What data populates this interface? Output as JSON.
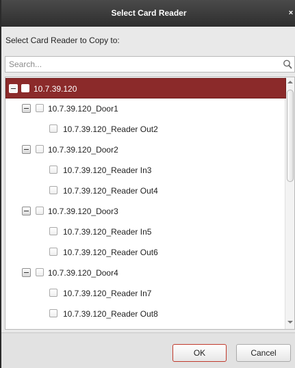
{
  "dialog": {
    "title": "Select Card Reader",
    "close_glyph": "×",
    "prompt": "Select Card Reader to Copy to:"
  },
  "search": {
    "placeholder": "Search...",
    "value": "",
    "icon": "search-icon"
  },
  "tree": {
    "items": [
      {
        "label": "10.7.39.120",
        "level": 0,
        "expandable": true,
        "selected": true,
        "checked": false
      },
      {
        "label": "10.7.39.120_Door1",
        "level": 1,
        "expandable": true,
        "selected": false,
        "checked": false
      },
      {
        "label": "10.7.39.120_Reader Out2",
        "level": 2,
        "expandable": false,
        "selected": false,
        "checked": false
      },
      {
        "label": "10.7.39.120_Door2",
        "level": 1,
        "expandable": true,
        "selected": false,
        "checked": false
      },
      {
        "label": "10.7.39.120_Reader In3",
        "level": 2,
        "expandable": false,
        "selected": false,
        "checked": false
      },
      {
        "label": "10.7.39.120_Reader Out4",
        "level": 2,
        "expandable": false,
        "selected": false,
        "checked": false
      },
      {
        "label": "10.7.39.120_Door3",
        "level": 1,
        "expandable": true,
        "selected": false,
        "checked": false
      },
      {
        "label": "10.7.39.120_Reader In5",
        "level": 2,
        "expandable": false,
        "selected": false,
        "checked": false
      },
      {
        "label": "10.7.39.120_Reader Out6",
        "level": 2,
        "expandable": false,
        "selected": false,
        "checked": false
      },
      {
        "label": "10.7.39.120_Door4",
        "level": 1,
        "expandable": true,
        "selected": false,
        "checked": false
      },
      {
        "label": "10.7.39.120_Reader In7",
        "level": 2,
        "expandable": false,
        "selected": false,
        "checked": false
      },
      {
        "label": "10.7.39.120_Reader Out8",
        "level": 2,
        "expandable": false,
        "selected": false,
        "checked": false
      }
    ]
  },
  "buttons": {
    "ok_label": "OK",
    "cancel_label": "Cancel"
  },
  "colors": {
    "titlebar": "#2e2e2e",
    "selected_row": "#8b2a2a",
    "ok_border": "#c0392b"
  }
}
